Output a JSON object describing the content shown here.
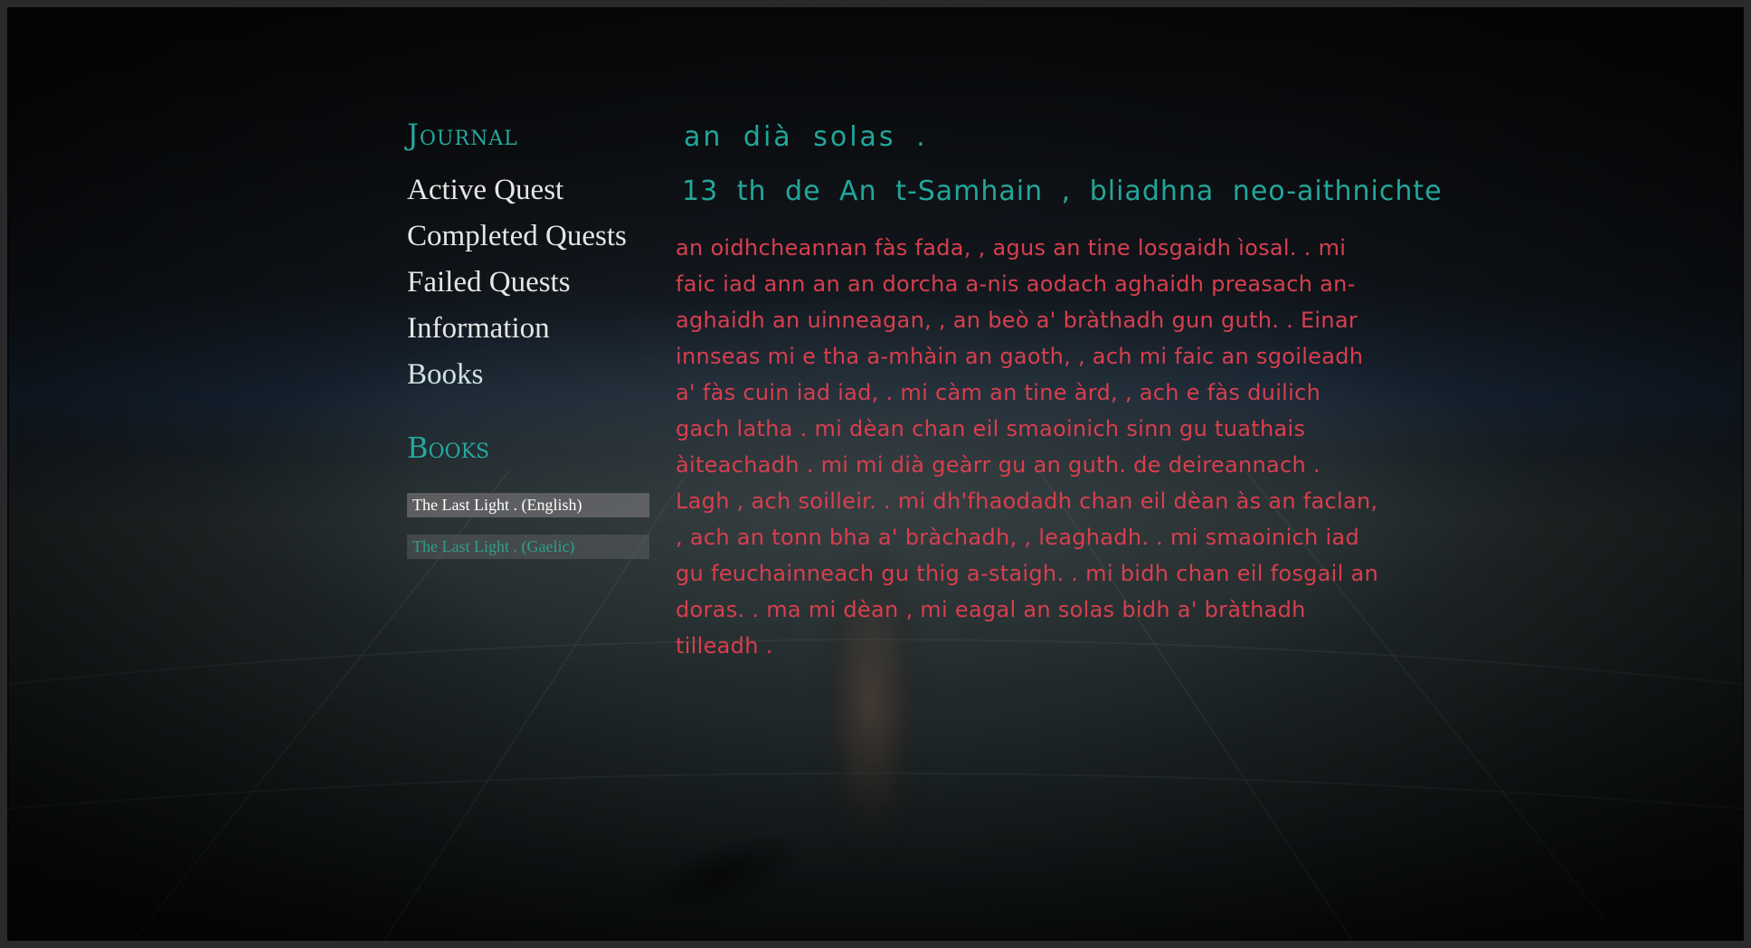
{
  "journal": {
    "title": "Journal",
    "nav": [
      {
        "label": "Active Quest"
      },
      {
        "label": "Completed Quests"
      },
      {
        "label": "Failed Quests"
      },
      {
        "label": "Information"
      },
      {
        "label": "Books"
      }
    ]
  },
  "books": {
    "heading": "Books",
    "items": [
      {
        "label": "The Last Light . (English)",
        "state": "normal"
      },
      {
        "label": "The Last Light . (Gaelic)",
        "state": "selected"
      }
    ]
  },
  "page": {
    "title": "an dià solas .",
    "date": "13 th de An t-Samhain , bliadhna neo-aithnichte",
    "body": "an oidhcheannan fàs fada, , agus an tine losgaidh ìosal. . mi faic iad ann an an dorcha a-nis aodach aghaidh preasach an-aghaidh an uinneagan, , an beò a' bràthadh gun guth. . Einar innseas mi e tha a-mhàin an gaoth, , ach mi faic an sgoileadh a' fàs cuin iad iad, . mi càm an tine àrd, , ach e fàs duilich gach latha . mi dèan chan eil smaoinich sinn gu tuathais àiteachadh . mi mi dià geàrr gu an guth. de deireannach . Lagh , ach soilleir. . mi dh'fhaodadh chan eil dèan às an faclan, , ach an tonn bha a' bràchadh, , leaghadh. . mi smaoinich iad gu feuchainneach gu thig a-staigh. . mi bidh chan eil fosgail an doras. . ma mi dèan , mi eagal an solas bidh a' bràthadh tilleadh ."
  },
  "colors": {
    "accent": "#27a79f",
    "nav_text": "#e6e6e4",
    "body_text": "#d83f4e",
    "selected_book": "#2f9f88"
  }
}
